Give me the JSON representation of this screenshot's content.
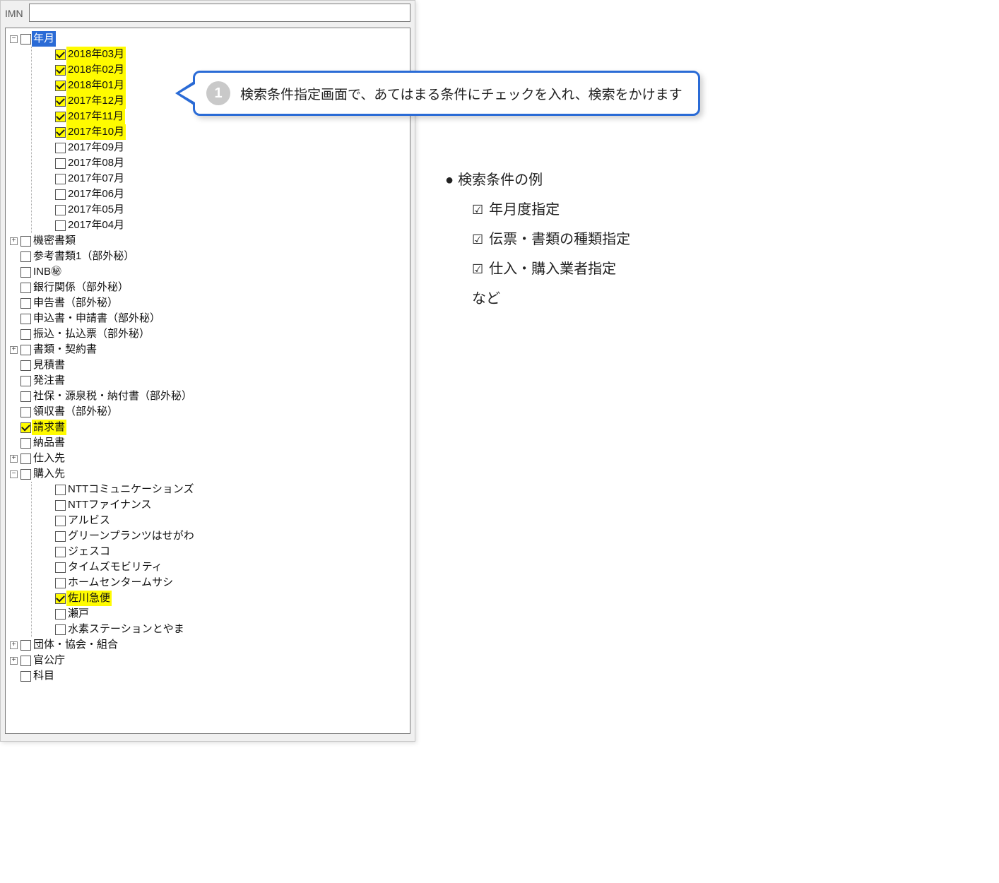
{
  "top": {
    "label": "IMN",
    "value": ""
  },
  "tree": {
    "root0": {
      "label": "年月",
      "expanded": true,
      "checked": false,
      "selected": true,
      "children": [
        {
          "label": "2018年03月",
          "checked": true,
          "highlight": true
        },
        {
          "label": "2018年02月",
          "checked": true,
          "highlight": true
        },
        {
          "label": "2018年01月",
          "checked": true,
          "highlight": true
        },
        {
          "label": "2017年12月",
          "checked": true,
          "highlight": true
        },
        {
          "label": "2017年11月",
          "checked": true,
          "highlight": true
        },
        {
          "label": "2017年10月",
          "checked": true,
          "highlight": true
        },
        {
          "label": "2017年09月",
          "checked": false,
          "highlight": false
        },
        {
          "label": "2017年08月",
          "checked": false,
          "highlight": false
        },
        {
          "label": "2017年07月",
          "checked": false,
          "highlight": false
        },
        {
          "label": "2017年06月",
          "checked": false,
          "highlight": false
        },
        {
          "label": "2017年05月",
          "checked": false,
          "highlight": false
        },
        {
          "label": "2017年04月",
          "checked": false,
          "highlight": false
        }
      ]
    },
    "flat": [
      {
        "label": "機密書類",
        "checked": false,
        "expander": "plus"
      },
      {
        "label": "参考書類1（部外秘）",
        "checked": false,
        "expander": "none"
      },
      {
        "label": "INB㊙",
        "checked": false,
        "expander": "none"
      },
      {
        "label": "銀行関係（部外秘）",
        "checked": false,
        "expander": "none"
      },
      {
        "label": "申告書（部外秘）",
        "checked": false,
        "expander": "none"
      },
      {
        "label": "申込書・申請書（部外秘）",
        "checked": false,
        "expander": "none"
      },
      {
        "label": "振込・払込票（部外秘）",
        "checked": false,
        "expander": "none"
      },
      {
        "label": "書類・契約書",
        "checked": false,
        "expander": "plus"
      },
      {
        "label": "見積書",
        "checked": false,
        "expander": "none"
      },
      {
        "label": "発注書",
        "checked": false,
        "expander": "none"
      },
      {
        "label": "社保・源泉税・納付書（部外秘）",
        "checked": false,
        "expander": "none"
      },
      {
        "label": "領収書（部外秘）",
        "checked": false,
        "expander": "none"
      },
      {
        "label": "請求書",
        "checked": true,
        "expander": "none",
        "highlight": true
      },
      {
        "label": "納品書",
        "checked": false,
        "expander": "none"
      },
      {
        "label": "仕入先",
        "checked": false,
        "expander": "plus"
      }
    ],
    "buyers": {
      "label": "購入先",
      "expanded": true,
      "checked": false,
      "children": [
        {
          "label": "NTTコミュニケーションズ",
          "checked": false
        },
        {
          "label": "NTTファイナンス",
          "checked": false
        },
        {
          "label": "アルビス",
          "checked": false
        },
        {
          "label": "グリーンプランツはせがわ",
          "checked": false
        },
        {
          "label": "ジェスコ",
          "checked": false
        },
        {
          "label": "タイムズモビリティ",
          "checked": false
        },
        {
          "label": "ホームセンタームサシ",
          "checked": false
        },
        {
          "label": "佐川急便",
          "checked": true,
          "highlight": true
        },
        {
          "label": "瀬戸",
          "checked": false
        },
        {
          "label": "水素ステーションとやま",
          "checked": false
        }
      ]
    },
    "tail": [
      {
        "label": "団体・協会・組合",
        "checked": false,
        "expander": "plus"
      },
      {
        "label": "官公庁",
        "checked": false,
        "expander": "plus"
      },
      {
        "label": "科目",
        "checked": false,
        "expander": "none"
      }
    ]
  },
  "callout": {
    "number": "1",
    "text": "検索条件指定画面で、あてはまる条件にチェックを入れ、検索をかけます"
  },
  "info": {
    "heading": "検索条件の例",
    "items": [
      "年月度指定",
      "伝票・書類の種類指定",
      "仕入・購入業者指定"
    ],
    "etc": "など"
  }
}
